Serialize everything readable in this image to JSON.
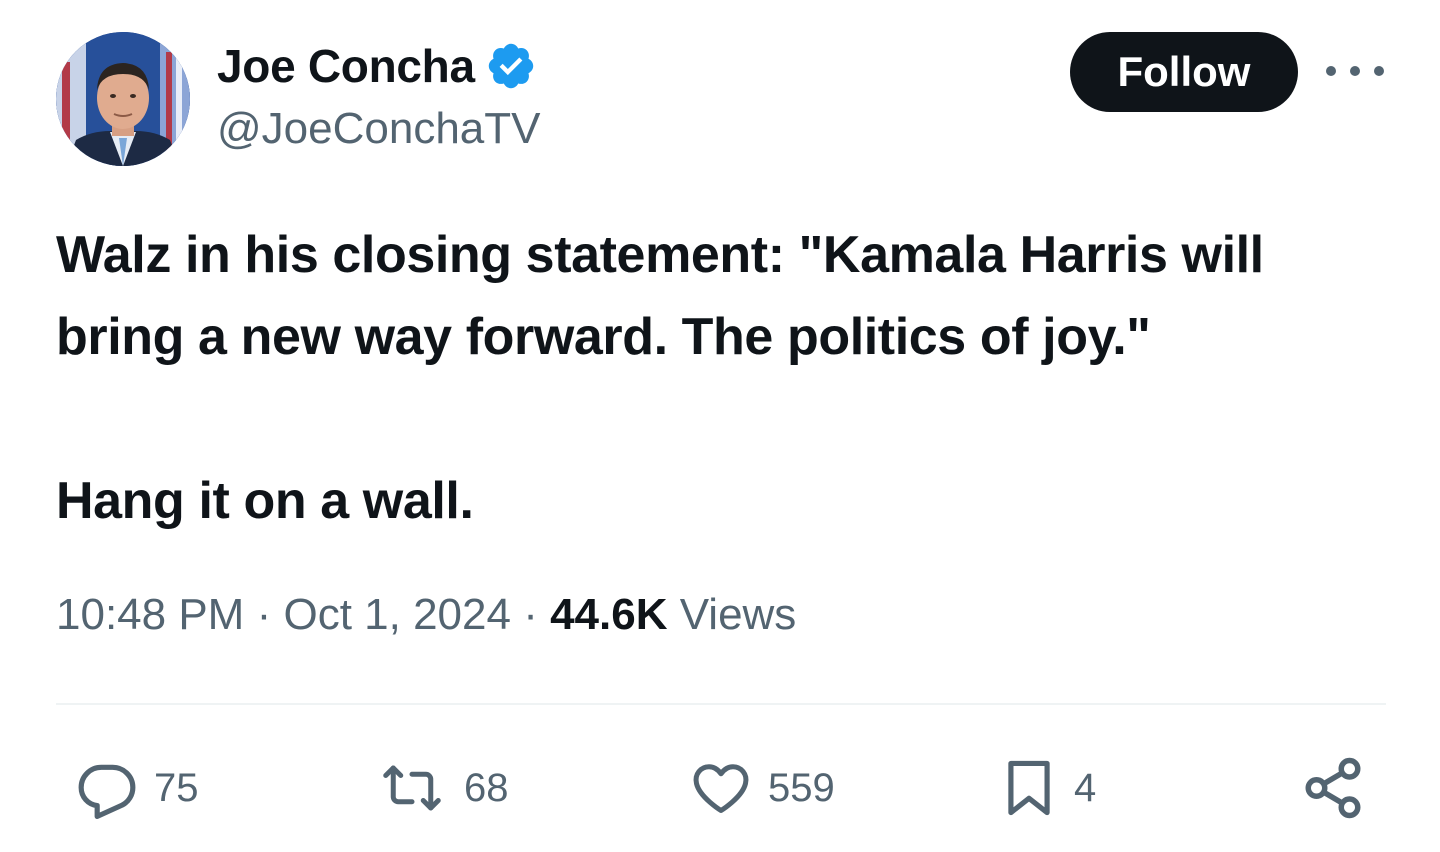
{
  "author": {
    "display_name": "Joe Concha",
    "handle": "@JoeConchaTV",
    "verified": true,
    "avatar_icon": "avatar-photo"
  },
  "header": {
    "follow_label": "Follow",
    "more_icon": "ellipsis-icon"
  },
  "tweet": {
    "line1": "Walz in his closing statement: \"Kamala Harris will bring a new way forward. The politics of joy.\"",
    "line2": "Hang it on a wall."
  },
  "meta": {
    "time": "10:48 PM",
    "separator": "·",
    "date": "Oct 1, 2024",
    "views_count": "44.6K",
    "views_label": "Views"
  },
  "actions": {
    "replies": "75",
    "reposts": "68",
    "likes": "559",
    "bookmarks": "4"
  },
  "colors": {
    "text_primary": "#0f1419",
    "text_secondary": "#536471",
    "verified_blue": "#1d9bf0",
    "divider": "#eff3f4"
  }
}
